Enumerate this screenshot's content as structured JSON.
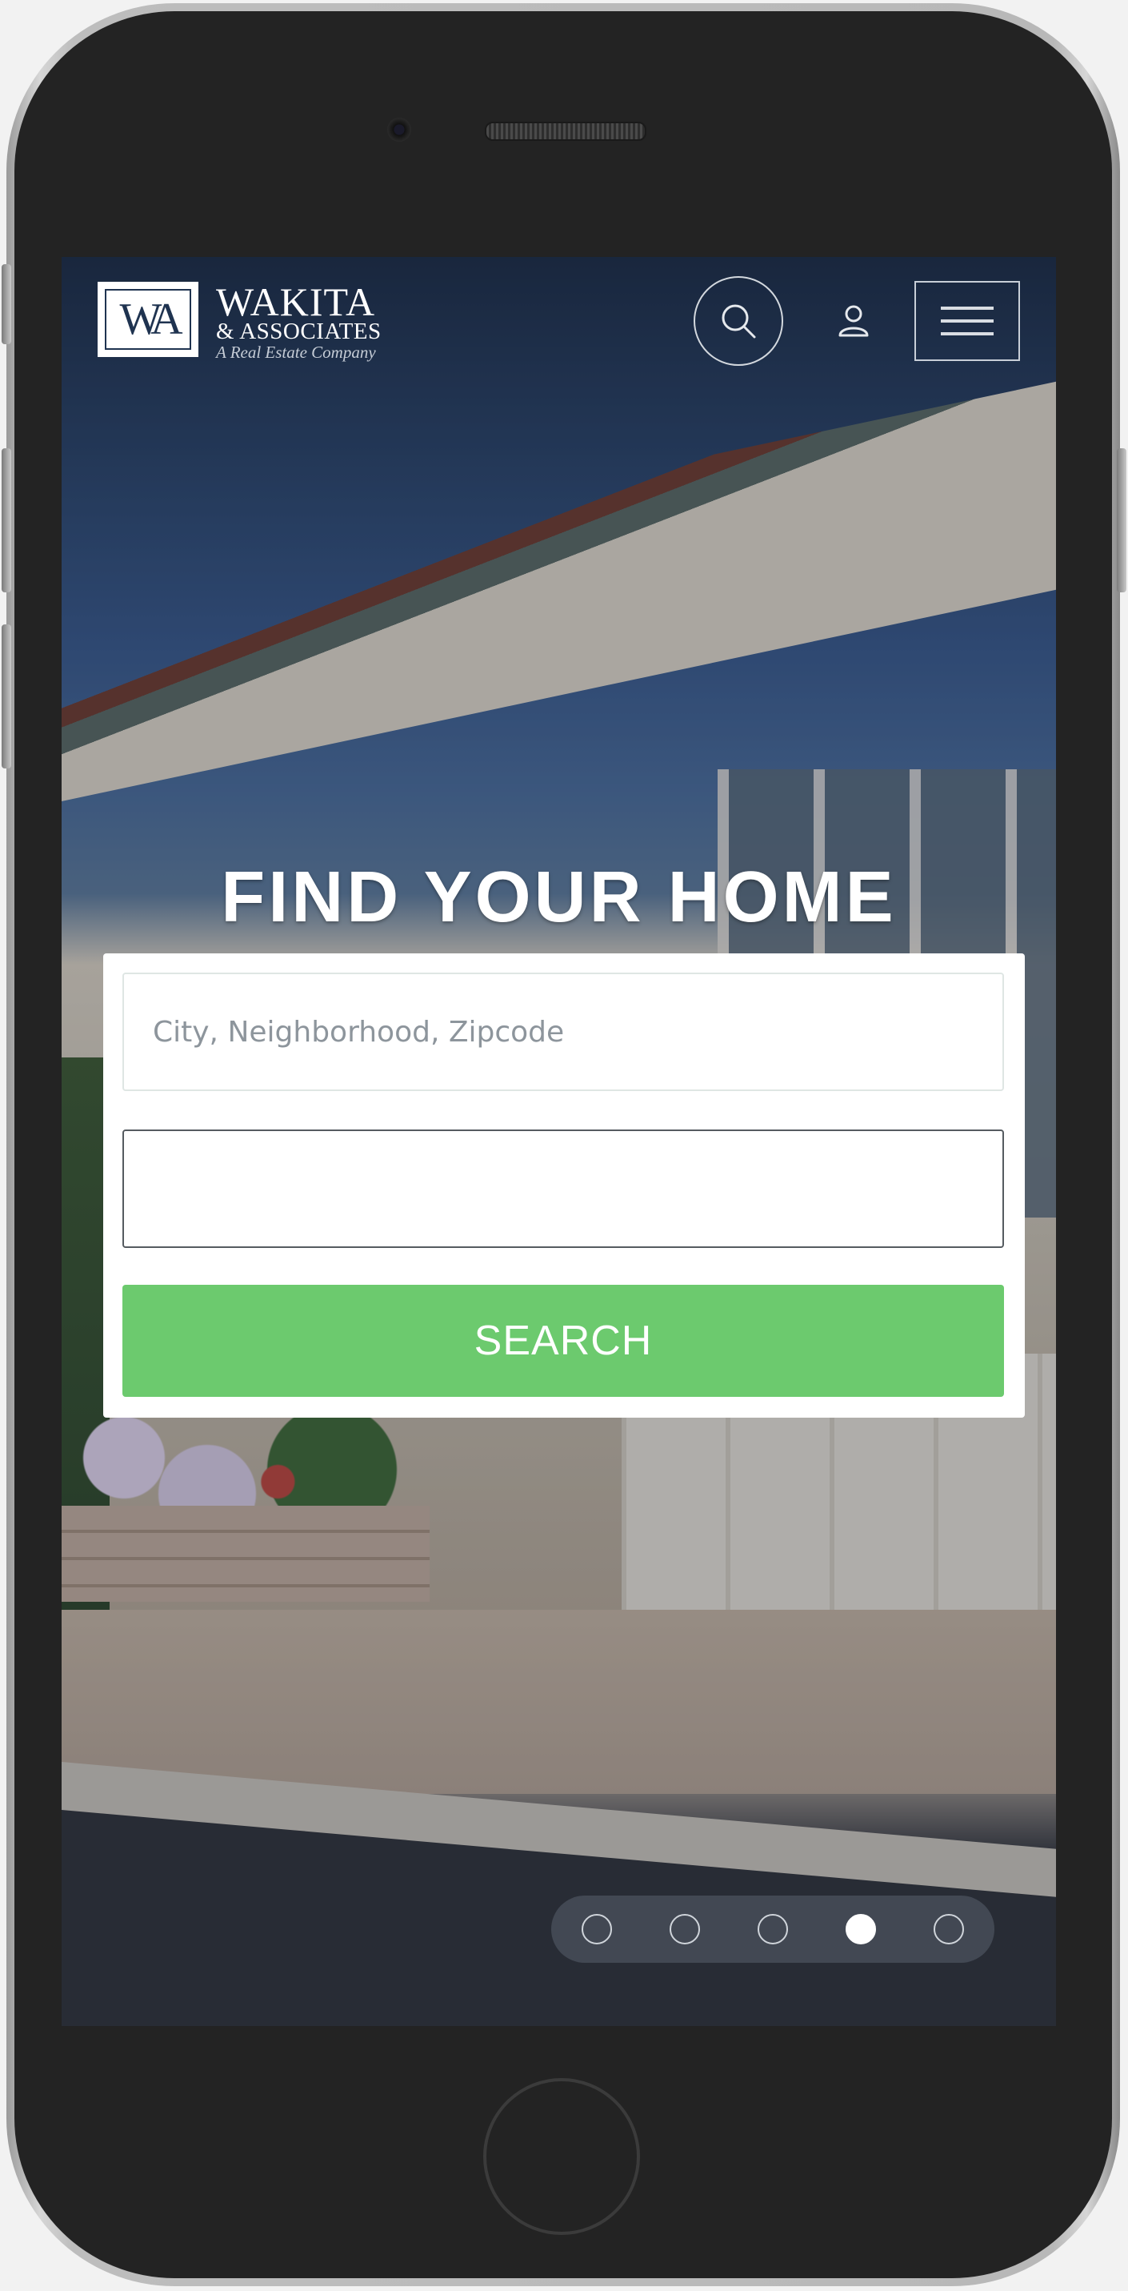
{
  "header": {
    "logo_mark": "WA",
    "logo_name": "WAKITA",
    "logo_sub": "& ASSOCIATES",
    "logo_tagline": "A Real Estate Company"
  },
  "icons": {
    "search": "search-icon",
    "user": "user-icon",
    "menu": "hamburger-menu-icon"
  },
  "hero": {
    "headline": "FIND YOUR HOME"
  },
  "search_form": {
    "location_placeholder": "City, Neighborhood, Zipcode",
    "location_value": "",
    "second_field_value": "",
    "search_button_label": "SEARCH"
  },
  "carousel": {
    "slide_count": 5,
    "active_index": 3
  },
  "colors": {
    "search_button": "#6cca6e",
    "phone_body": "#232323",
    "logo_navy": "#1f3350"
  }
}
